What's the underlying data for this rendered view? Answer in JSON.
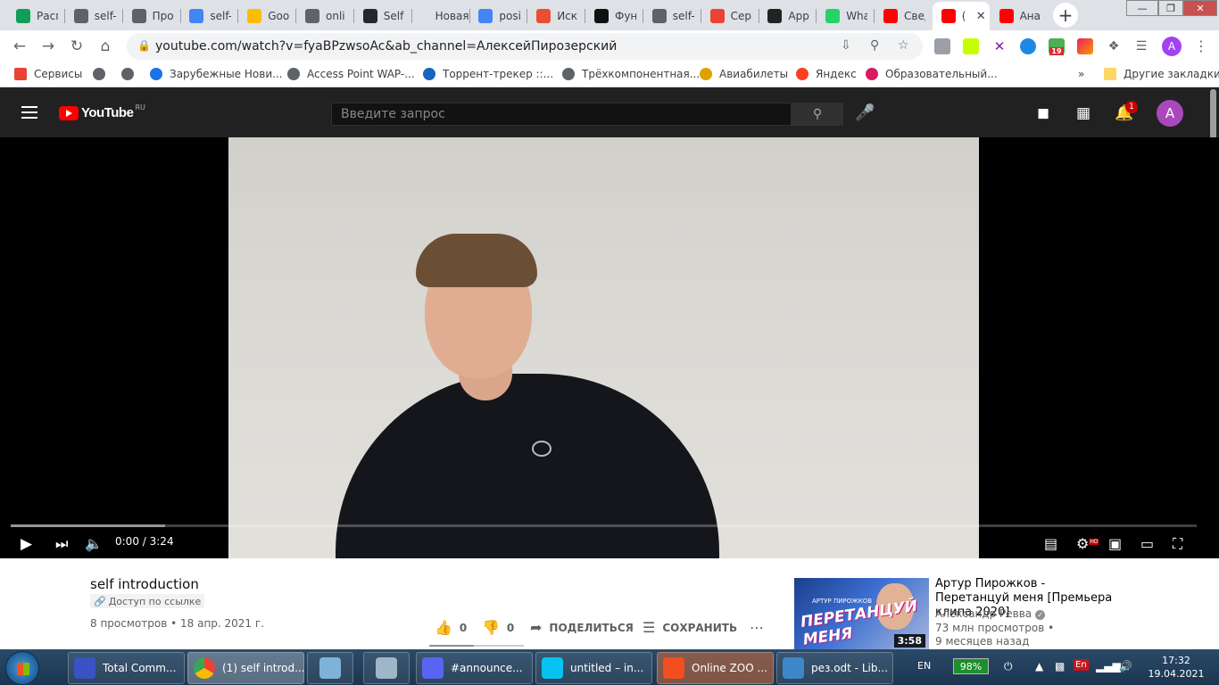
{
  "browser": {
    "tabs": [
      {
        "title": "Расп",
        "icon": "sheets-icon",
        "color": "#0f9d58"
      },
      {
        "title": "self-",
        "icon": "globe-icon",
        "color": "#5f6368"
      },
      {
        "title": "Про",
        "icon": "globe-icon",
        "color": "#5f6368"
      },
      {
        "title": "self-",
        "icon": "docs-icon",
        "color": "#4285f4"
      },
      {
        "title": "Goo",
        "icon": "drive-icon",
        "color": "#fbbc04"
      },
      {
        "title": "onli",
        "icon": "globe-icon",
        "color": "#5f6368"
      },
      {
        "title": "Self",
        "icon": "github-icon",
        "color": "#24292e"
      },
      {
        "title": "Новая вк",
        "icon": "none",
        "color": "#dee1e6"
      },
      {
        "title": "posit",
        "icon": "google-icon",
        "color": "#4285f4"
      },
      {
        "title": "Иск",
        "icon": "code-icon",
        "color": "#e94e32"
      },
      {
        "title": "Фун",
        "icon": "hexlet-icon",
        "color": "#111111"
      },
      {
        "title": "self-",
        "icon": "globe-icon",
        "color": "#5f6368"
      },
      {
        "title": "Серв",
        "icon": "apps-icon",
        "color": "#ea4335"
      },
      {
        "title": "App",
        "icon": "rs-icon",
        "color": "#222222"
      },
      {
        "title": "Wha",
        "icon": "whatsapp-icon",
        "color": "#25d366"
      },
      {
        "title": "Свед",
        "icon": "youtube-icon",
        "color": "#ff0000"
      },
      {
        "title": "(",
        "icon": "youtube-icon",
        "color": "#ff0000",
        "active": true
      },
      {
        "title": "Ана",
        "icon": "youtube-icon",
        "color": "#ff0000"
      }
    ],
    "url": "youtube.com/watch?v=fyaBPzwsoAc&ab_channel=АлексейПирозерский",
    "profile_letter": "A",
    "ext_badge": "19",
    "bookmarks": [
      {
        "label": "Сервисы",
        "icon": "apps-icon"
      },
      {
        "label": "",
        "icon": "globe-icon"
      },
      {
        "label": "",
        "icon": "globe-icon"
      },
      {
        "label": "Зарубежные Нови...",
        "icon": "ip-icon"
      },
      {
        "label": "Access Point WAP-...",
        "icon": "globe-icon"
      },
      {
        "label": "Торрент-трекер ::...",
        "icon": "butterfly-icon"
      },
      {
        "label": "Трёхкомпонентная...",
        "icon": "globe-icon"
      },
      {
        "label": "Авиабилеты",
        "icon": "plane-icon"
      },
      {
        "label": "Яндекс",
        "icon": "yandex-icon"
      },
      {
        "label": "Образовательный...",
        "icon": "edu-icon"
      }
    ],
    "bookmarks_more": "»",
    "other_bookmarks": "Другие закладки"
  },
  "youtube": {
    "logo_text": "YouTube",
    "logo_region": "RU",
    "search_placeholder": "Введите запрос",
    "notifications_count": "1",
    "avatar_letter": "A",
    "player": {
      "time_current": "0:00",
      "time_total": "3:24",
      "time_sep": " / ",
      "quality_badge": "HD",
      "buffered_fraction": 0.13
    },
    "video": {
      "title": "self introduction",
      "access": "Доступ по ссылке",
      "views": "8 просмотров",
      "date": "18 апр. 2021 г.",
      "likes": "0",
      "dislikes": "0",
      "share": "ПОДЕЛИТЬСЯ",
      "save": "СОХРАНИТЬ"
    },
    "recommendation": {
      "title": "Артур Пирожков - Перетанцуй меня [Премьера клипа 2020]",
      "channel": "Александр Ревва",
      "views": "73 млн просмотров •",
      "date": "9 месяцев назад",
      "duration": "3:58",
      "thumb_text": "ПЕРЕТАНЦУЙ МЕНЯ",
      "thumb_small": "АРТУР ПИРОЖКОВ"
    }
  },
  "taskbar": {
    "items": [
      {
        "label": "Total Comm...",
        "icon": "total-commander-icon",
        "color": "#3a52c4"
      },
      {
        "label": "(1) self introd...",
        "icon": "chrome-icon",
        "color": "#e34133",
        "active": true
      },
      {
        "label": "",
        "icon": "notes-icon",
        "color": "#7fb2d9"
      },
      {
        "label": "",
        "icon": "calculator-icon",
        "color": "#9fb6c9"
      },
      {
        "label": "#announce...",
        "icon": "discord-icon",
        "color": "#5865f2"
      },
      {
        "label": "untitled – in...",
        "icon": "webstorm-icon",
        "color": "#07c3f2"
      },
      {
        "label": "Online ZOO ...",
        "icon": "figma-icon",
        "color": "#f24e1e"
      },
      {
        "label": "рез.odt - Lib...",
        "icon": "writer-icon",
        "color": "#3d87c9"
      }
    ],
    "lang": "EN",
    "battery": "98%",
    "tray_lang_badge": "En",
    "time": "17:32",
    "date": "19.04.2021"
  }
}
